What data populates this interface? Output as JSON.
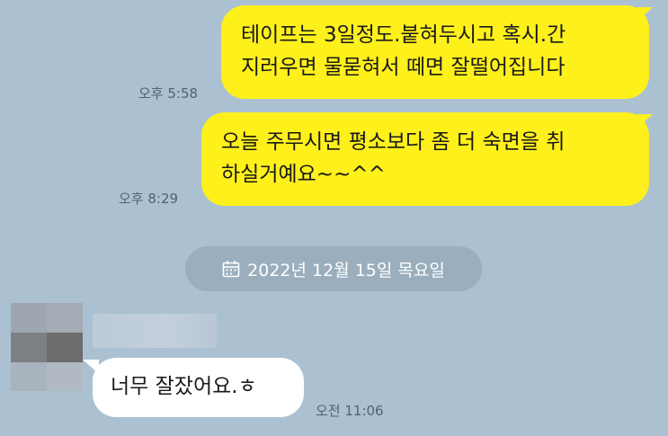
{
  "messages": [
    {
      "direction": "outgoing",
      "lines": [
        "테이프는 3일정도.붙혀두시고 혹시.간",
        "지러우면 물묻혀서 떼면 잘떨어집니다"
      ],
      "time": "오후 5:58"
    },
    {
      "direction": "outgoing",
      "lines": [
        "오늘 주무시면 평소보다 좀 더 숙면을 취",
        "하실거예요~~^^"
      ],
      "time": "오후 8:29"
    },
    {
      "direction": "incoming",
      "lines": [
        "너무 잘잤어요.ㅎ"
      ],
      "time": "오전 11:06"
    }
  ],
  "date_divider": {
    "icon": "calendar-icon",
    "text": "2022년 12월 15일 목요일"
  },
  "colors": {
    "background": "#abc1d1",
    "outgoing_bubble": "#fef01b",
    "incoming_bubble": "#ffffff",
    "date_pill": "#9aaebd"
  }
}
